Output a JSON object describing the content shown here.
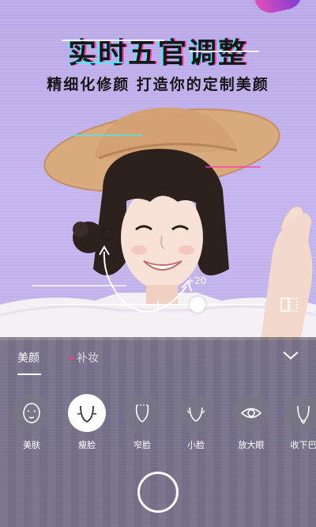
{
  "promo": {
    "headline": "实时五官调整",
    "subheadline": "精细化修颜 打造你的定制美颜"
  },
  "adjust": {
    "value_label": "+20",
    "value": 20
  },
  "panel": {
    "tabs": [
      {
        "label": "美颜",
        "active": true
      },
      {
        "label": "补妆",
        "active": false
      }
    ],
    "tools": [
      {
        "label": "美肤",
        "icon": "face-skin-icon",
        "active": false
      },
      {
        "label": "瘦脸",
        "icon": "face-slim-icon",
        "active": true
      },
      {
        "label": "窄脸",
        "icon": "face-narrow-icon",
        "active": false
      },
      {
        "label": "小脸",
        "icon": "face-small-icon",
        "active": false
      },
      {
        "label": "放大眼",
        "icon": "eye-enlarge-icon",
        "active": false
      },
      {
        "label": "收下巴",
        "icon": "chin-icon",
        "active": false
      }
    ]
  },
  "colors": {
    "background": "#b9a9e6",
    "accent_pink": "#ff3bb0",
    "accent_cyan": "#3ff0ff",
    "dot_red": "#ff3b6b"
  }
}
